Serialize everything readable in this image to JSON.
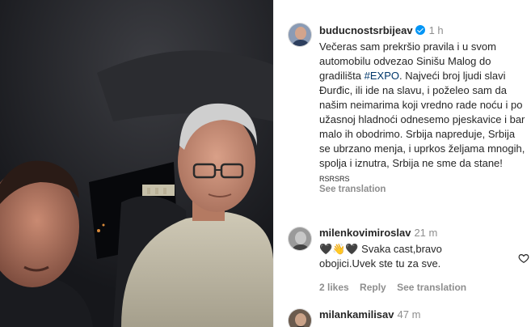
{
  "video": {
    "description_icon": "video-frame"
  },
  "post": {
    "username": "buducnostsrbijeav",
    "time": "1 h",
    "caption_before": "Večeras sam prekršio pravila i u svom automobilu odvezao Sinišu Malog do gradilišta ",
    "hashtag": "#EXPO",
    "caption_after": ". Najveći broj ljudi slavi Đurđic, ili ide na slavu, i poželeo sam da našim neimarima koji vredno rade noću i po užasnoj hladnoći odnesemo pjeskavice i bar malo ih obodrimo. Srbija napreduje, Srbija se ubrzano menja, i uprkos željama mnogih, spolja i iznutra, Srbija ne sme da stane!",
    "tag_line": "RSRSRS",
    "see_translation": "See translation"
  },
  "comments": [
    {
      "username": "milenkovimiroslav",
      "time": "21 m",
      "text": "🖤👋🖤 Svaka cast,bravo obojici.Uvek ste tu za sve.",
      "likes": "2 likes",
      "reply": "Reply",
      "see_translation": "See translation"
    },
    {
      "username": "milankamilisav",
      "time": "47 m"
    }
  ],
  "colors": {
    "link": "#00376b",
    "muted": "#8e8e8e",
    "verified": "#0095f6"
  }
}
